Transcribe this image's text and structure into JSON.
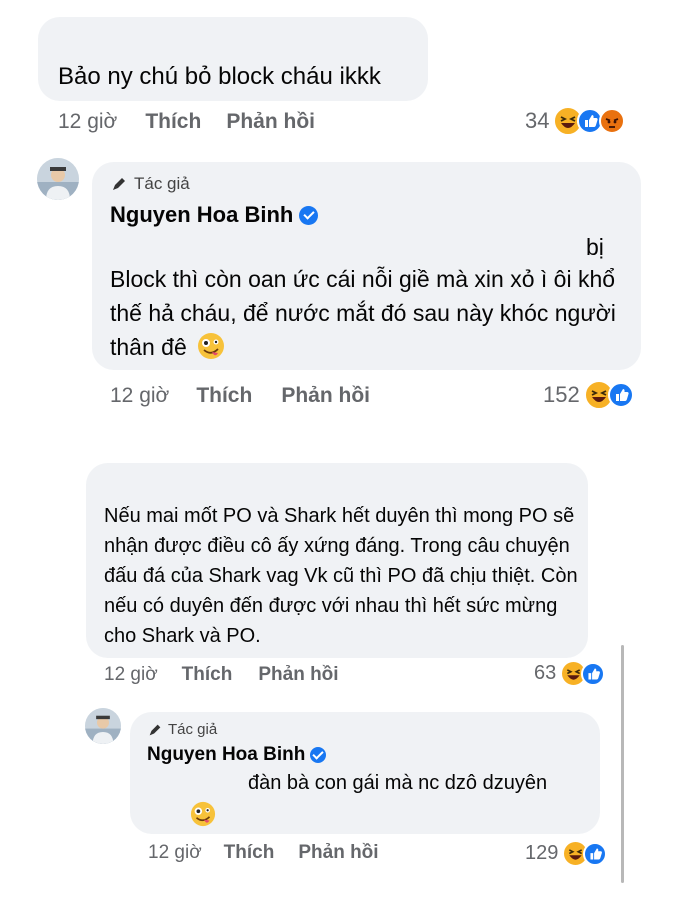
{
  "comments": [
    {
      "text": "Bảo ny chú bỏ block cháu ikkk",
      "time": "12 giờ",
      "like": "Thích",
      "reply": "Phản hồi",
      "count": "34",
      "reactions": [
        "haha-icon",
        "like-icon",
        "angry-icon"
      ]
    },
    {
      "author_tag": "Tác giả",
      "author": "Nguyen Hoa Binh",
      "text_top": "bị",
      "text": "Block thì còn oan ức cái nỗi giề mà xin xỏ ì ôi khổ thế hả cháu, để nước mắt đó sau này khóc người thân đê",
      "time": "12 giờ",
      "like": "Thích",
      "reply": "Phản hồi",
      "count": "152",
      "reactions": [
        "haha-icon",
        "like-icon"
      ]
    },
    {
      "text": "Nếu mai mốt PO và Shark hết duyên thì mong PO sẽ nhận được điều cô ấy xứng đáng. Trong câu chuyện đấu đá của Shark vag Vk cũ thì PO đã chịu thiệt. Còn nếu có duyên đến được với nhau thì hết sức mừng cho Shark và PO.",
      "time": "12 giờ",
      "like": "Thích",
      "reply": "Phản hồi",
      "count": "63",
      "reactions": [
        "haha-icon",
        "like-icon"
      ]
    },
    {
      "author_tag": "Tác giả",
      "author": "Nguyen Hoa Binh",
      "text": "đàn bà con gái mà nc dzô dzuyên",
      "time": "12 giờ",
      "like": "Thích",
      "reply": "Phản hồi",
      "count": "129",
      "reactions": [
        "haha-icon",
        "like-icon"
      ]
    }
  ],
  "colors": {
    "bubble": "#f0f2f5",
    "meta": "#65676b",
    "like": "#1877f2",
    "haha": "#f7b125",
    "angry": "#e9710f"
  }
}
